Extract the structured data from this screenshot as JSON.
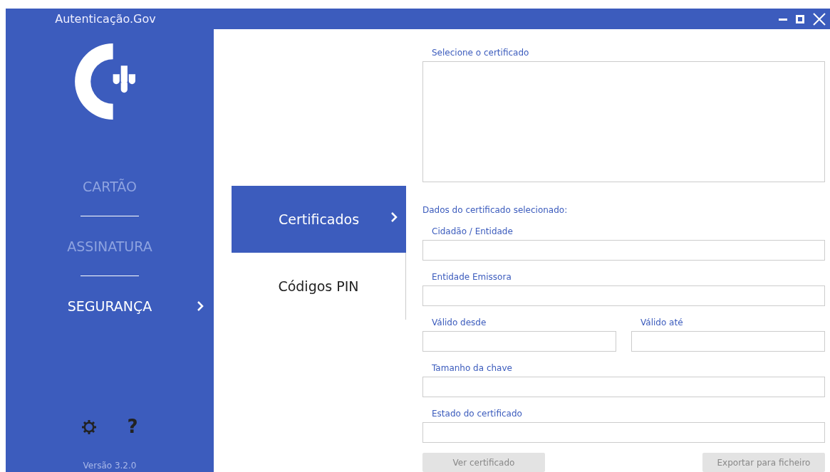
{
  "window": {
    "title": "Autenticação.Gov"
  },
  "sidebar": {
    "items": [
      {
        "label": "CARTÃO",
        "selected": false
      },
      {
        "label": "ASSINATURA",
        "selected": false
      },
      {
        "label": "SEGURANÇA",
        "selected": true
      }
    ],
    "help": "?",
    "version": "Versão 3.2.0"
  },
  "subnav": [
    {
      "label": "Certificados",
      "selected": true
    },
    {
      "label": "Códigos PIN",
      "selected": false
    }
  ],
  "form": {
    "list_label": "Selecione o certificado",
    "section_title": "Dados do certificado selecionado:",
    "fields": [
      {
        "label": "Cidadão / Entidade",
        "kind": "full"
      },
      {
        "label": "Entidade Emissora",
        "kind": "full"
      },
      {
        "label": "Válido desde",
        "kind": "half"
      },
      {
        "label": "Válido até",
        "kind": "half"
      },
      {
        "label": "Tamanho da chave",
        "kind": "full"
      },
      {
        "label": "Estado do certificado",
        "kind": "full"
      }
    ],
    "buttons": [
      {
        "label": "Ver certificado",
        "disabled": true
      },
      {
        "label": "Exportar para ficheiro",
        "disabled": true
      }
    ]
  }
}
